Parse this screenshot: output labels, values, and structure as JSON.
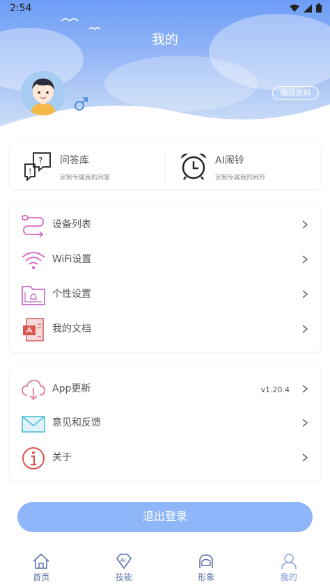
{
  "status_bar": {
    "time": "2:54"
  },
  "header": {
    "title": "我的",
    "edit_label": "编辑资料"
  },
  "features": [
    {
      "title": "问答库",
      "subtitle": "定制专属我的问答",
      "icon": "qa-icon"
    },
    {
      "title": "AI闹铃",
      "subtitle": "定制专属我的闹铃",
      "icon": "alarm-clock-icon"
    }
  ],
  "menu_group1": [
    {
      "label": "设备列表",
      "icon": "device-list-icon"
    },
    {
      "label": "WiFi设置",
      "icon": "wifi-icon"
    },
    {
      "label": "个性设置",
      "icon": "personal-settings-icon"
    },
    {
      "label": "我的文档",
      "icon": "document-icon"
    }
  ],
  "menu_group2": [
    {
      "label": "App更新",
      "icon": "cloud-download-icon",
      "value": "v1.20.4"
    },
    {
      "label": "意见和反馈",
      "icon": "envelope-icon"
    },
    {
      "label": "关于",
      "icon": "info-icon"
    }
  ],
  "logout_label": "退出登录",
  "tabs": [
    {
      "label": "首页",
      "icon": "home-icon"
    },
    {
      "label": "技能",
      "icon": "skill-icon"
    },
    {
      "label": "形象",
      "icon": "avatar-icon"
    },
    {
      "label": "我的",
      "icon": "user-icon",
      "active": true
    }
  ],
  "colors": {
    "header": "#8fb3f6",
    "button": "#8fb6f8",
    "tab_text": "#5a70a8"
  }
}
